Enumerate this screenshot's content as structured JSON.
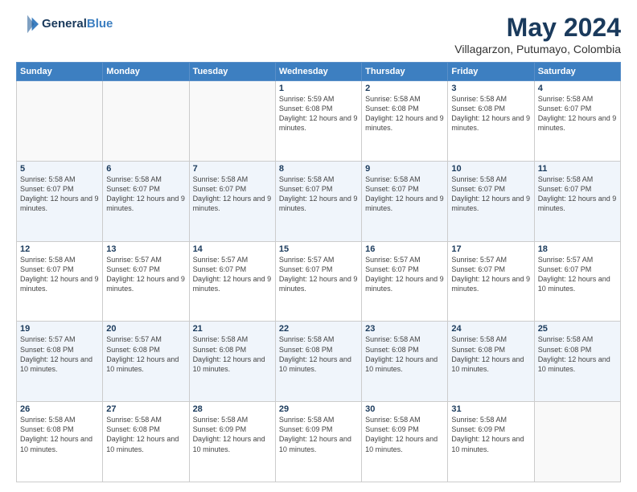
{
  "header": {
    "logo_line1": "General",
    "logo_line2": "Blue",
    "month_title": "May 2024",
    "subtitle": "Villagarzon, Putumayo, Colombia"
  },
  "days_of_week": [
    "Sunday",
    "Monday",
    "Tuesday",
    "Wednesday",
    "Thursday",
    "Friday",
    "Saturday"
  ],
  "weeks": [
    [
      {
        "day": "",
        "info": ""
      },
      {
        "day": "",
        "info": ""
      },
      {
        "day": "",
        "info": ""
      },
      {
        "day": "1",
        "info": "Sunrise: 5:59 AM\nSunset: 6:08 PM\nDaylight: 12 hours\nand 9 minutes."
      },
      {
        "day": "2",
        "info": "Sunrise: 5:58 AM\nSunset: 6:08 PM\nDaylight: 12 hours\nand 9 minutes."
      },
      {
        "day": "3",
        "info": "Sunrise: 5:58 AM\nSunset: 6:08 PM\nDaylight: 12 hours\nand 9 minutes."
      },
      {
        "day": "4",
        "info": "Sunrise: 5:58 AM\nSunset: 6:07 PM\nDaylight: 12 hours\nand 9 minutes."
      }
    ],
    [
      {
        "day": "5",
        "info": "Sunrise: 5:58 AM\nSunset: 6:07 PM\nDaylight: 12 hours\nand 9 minutes."
      },
      {
        "day": "6",
        "info": "Sunrise: 5:58 AM\nSunset: 6:07 PM\nDaylight: 12 hours\nand 9 minutes."
      },
      {
        "day": "7",
        "info": "Sunrise: 5:58 AM\nSunset: 6:07 PM\nDaylight: 12 hours\nand 9 minutes."
      },
      {
        "day": "8",
        "info": "Sunrise: 5:58 AM\nSunset: 6:07 PM\nDaylight: 12 hours\nand 9 minutes."
      },
      {
        "day": "9",
        "info": "Sunrise: 5:58 AM\nSunset: 6:07 PM\nDaylight: 12 hours\nand 9 minutes."
      },
      {
        "day": "10",
        "info": "Sunrise: 5:58 AM\nSunset: 6:07 PM\nDaylight: 12 hours\nand 9 minutes."
      },
      {
        "day": "11",
        "info": "Sunrise: 5:58 AM\nSunset: 6:07 PM\nDaylight: 12 hours\nand 9 minutes."
      }
    ],
    [
      {
        "day": "12",
        "info": "Sunrise: 5:58 AM\nSunset: 6:07 PM\nDaylight: 12 hours\nand 9 minutes."
      },
      {
        "day": "13",
        "info": "Sunrise: 5:57 AM\nSunset: 6:07 PM\nDaylight: 12 hours\nand 9 minutes."
      },
      {
        "day": "14",
        "info": "Sunrise: 5:57 AM\nSunset: 6:07 PM\nDaylight: 12 hours\nand 9 minutes."
      },
      {
        "day": "15",
        "info": "Sunrise: 5:57 AM\nSunset: 6:07 PM\nDaylight: 12 hours\nand 9 minutes."
      },
      {
        "day": "16",
        "info": "Sunrise: 5:57 AM\nSunset: 6:07 PM\nDaylight: 12 hours\nand 9 minutes."
      },
      {
        "day": "17",
        "info": "Sunrise: 5:57 AM\nSunset: 6:07 PM\nDaylight: 12 hours\nand 9 minutes."
      },
      {
        "day": "18",
        "info": "Sunrise: 5:57 AM\nSunset: 6:07 PM\nDaylight: 12 hours\nand 10 minutes."
      }
    ],
    [
      {
        "day": "19",
        "info": "Sunrise: 5:57 AM\nSunset: 6:08 PM\nDaylight: 12 hours\nand 10 minutes."
      },
      {
        "day": "20",
        "info": "Sunrise: 5:57 AM\nSunset: 6:08 PM\nDaylight: 12 hours\nand 10 minutes."
      },
      {
        "day": "21",
        "info": "Sunrise: 5:58 AM\nSunset: 6:08 PM\nDaylight: 12 hours\nand 10 minutes."
      },
      {
        "day": "22",
        "info": "Sunrise: 5:58 AM\nSunset: 6:08 PM\nDaylight: 12 hours\nand 10 minutes."
      },
      {
        "day": "23",
        "info": "Sunrise: 5:58 AM\nSunset: 6:08 PM\nDaylight: 12 hours\nand 10 minutes."
      },
      {
        "day": "24",
        "info": "Sunrise: 5:58 AM\nSunset: 6:08 PM\nDaylight: 12 hours\nand 10 minutes."
      },
      {
        "day": "25",
        "info": "Sunrise: 5:58 AM\nSunset: 6:08 PM\nDaylight: 12 hours\nand 10 minutes."
      }
    ],
    [
      {
        "day": "26",
        "info": "Sunrise: 5:58 AM\nSunset: 6:08 PM\nDaylight: 12 hours\nand 10 minutes."
      },
      {
        "day": "27",
        "info": "Sunrise: 5:58 AM\nSunset: 6:08 PM\nDaylight: 12 hours\nand 10 minutes."
      },
      {
        "day": "28",
        "info": "Sunrise: 5:58 AM\nSunset: 6:09 PM\nDaylight: 12 hours\nand 10 minutes."
      },
      {
        "day": "29",
        "info": "Sunrise: 5:58 AM\nSunset: 6:09 PM\nDaylight: 12 hours\nand 10 minutes."
      },
      {
        "day": "30",
        "info": "Sunrise: 5:58 AM\nSunset: 6:09 PM\nDaylight: 12 hours\nand 10 minutes."
      },
      {
        "day": "31",
        "info": "Sunrise: 5:58 AM\nSunset: 6:09 PM\nDaylight: 12 hours\nand 10 minutes."
      },
      {
        "day": "",
        "info": ""
      }
    ]
  ]
}
